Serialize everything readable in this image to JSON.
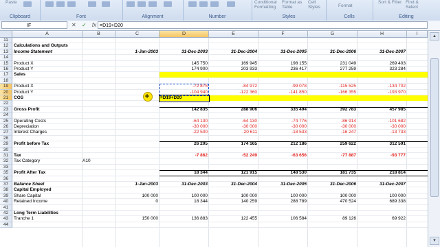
{
  "ribbon": {
    "groups": [
      {
        "label": "Clipboard"
      },
      {
        "label": "Font"
      },
      {
        "label": "Alignment"
      },
      {
        "label": "Number"
      },
      {
        "label": "Styles"
      },
      {
        "label": "Cells"
      },
      {
        "label": "Editing"
      }
    ],
    "paste": "Paste",
    "cond_format": "Conditional Formatting",
    "format_table": "Format as Table",
    "cell_styles": "Cell Styles",
    "format": "Format",
    "sort_filter": "Sort & Filter",
    "find_select": "Find & Select"
  },
  "formula_bar": {
    "name_box": "IF",
    "cancel": "✕",
    "enter": "✓",
    "fx": "fx",
    "formula": "=D19+D20"
  },
  "columns": [
    "A",
    "B",
    "C",
    "D",
    "E",
    "F",
    "G",
    "H",
    "I"
  ],
  "rows": [
    {
      "n": "11",
      "a": "",
      "b": "",
      "c": "",
      "d": "",
      "e": "",
      "f": "",
      "g": "",
      "h": ""
    },
    {
      "n": "12",
      "a": "Calculations and Outputs",
      "b": "",
      "c": "",
      "d": "",
      "e": "",
      "f": "",
      "g": "",
      "h": "",
      "bold": true
    },
    {
      "n": "13",
      "a": "Income Statement",
      "b": "",
      "c": "1-Jan-2003",
      "d": "31-Dec-2003",
      "e": "31-Dec-2004",
      "f": "31-Dec-2005",
      "g": "31-Dec-2006",
      "h": "31-Dec-2007",
      "bold": true,
      "italic": true
    },
    {
      "n": "14",
      "a": "",
      "b": "",
      "c": "",
      "d": "",
      "e": "",
      "f": "",
      "g": "",
      "h": ""
    },
    {
      "n": "15",
      "a": "Product X",
      "b": "",
      "c": "",
      "d": "145 750",
      "e": "169 945",
      "f": "198 155",
      "g": "231 049",
      "h": "269 403"
    },
    {
      "n": "16",
      "a": "Product Y",
      "b": "",
      "c": "",
      "d": "174 900",
      "e": "203 933",
      "f": "236 417",
      "g": "277 259",
      "h": "323 284"
    },
    {
      "n": "17",
      "a": "Sales",
      "b": "",
      "c": "",
      "d": "",
      "e": "",
      "f": "",
      "g": "",
      "h": "",
      "bold": true
    },
    {
      "n": "18",
      "a": "",
      "b": "",
      "c": "",
      "d": "",
      "e": "",
      "f": "",
      "g": "",
      "h": ""
    },
    {
      "n": "19",
      "a": "Product X",
      "b": "",
      "c": "",
      "d": "-72 875",
      "e": "-84 972",
      "f": "-99 078",
      "g": "-115 525",
      "h": "-134 702",
      "red": true
    },
    {
      "n": "20",
      "a": "Product Y",
      "b": "",
      "c": "",
      "d": "-104 940",
      "e": "-122 360",
      "f": "-141 850",
      "g": "-166 355",
      "h": "-193 970",
      "red": true
    },
    {
      "n": "21",
      "a": "COS",
      "b": "",
      "c": "",
      "d": "=D19+D20",
      "e": "",
      "f": "",
      "g": "",
      "h": "",
      "bold": true
    },
    {
      "n": "22",
      "a": "",
      "b": "",
      "c": "",
      "d": "",
      "e": "",
      "f": "",
      "g": "",
      "h": ""
    },
    {
      "n": "23",
      "a": "Gross Profit",
      "b": "",
      "c": "",
      "d": "142 835",
      "e": "288 906",
      "f": "335 494",
      "g": "392 783",
      "h": "457 985",
      "bold": true
    },
    {
      "n": "24",
      "a": "",
      "b": "",
      "c": "",
      "d": "",
      "e": "",
      "f": "",
      "g": "",
      "h": ""
    },
    {
      "n": "25",
      "a": "Operating Costs",
      "b": "",
      "c": "",
      "d": "-64 130",
      "e": "-64 130",
      "f": "-74 776",
      "g": "-86 914",
      "h": "-101 682",
      "red": true
    },
    {
      "n": "26",
      "a": "Depreciation",
      "b": "",
      "c": "",
      "d": "-30 000",
      "e": "-30 000",
      "f": "-30 000",
      "g": "-30 000",
      "h": "-30 000",
      "red": true
    },
    {
      "n": "27",
      "a": "Interest Charges",
      "b": "",
      "c": "",
      "d": "-22 500",
      "e": "-20 611",
      "f": "-18 533",
      "g": "-16 247",
      "h": "-13 733",
      "red": true
    },
    {
      "n": "28",
      "a": "",
      "b": "",
      "c": "",
      "d": "",
      "e": "",
      "f": "",
      "g": "",
      "h": ""
    },
    {
      "n": "29",
      "a": "Profit before Tax",
      "b": "",
      "c": "",
      "d": "26 205",
      "e": "174 165",
      "f": "212 186",
      "g": "259 622",
      "h": "312 591",
      "bold": true
    },
    {
      "n": "30",
      "a": "",
      "b": "",
      "c": "",
      "d": "",
      "e": "",
      "f": "",
      "g": "",
      "h": ""
    },
    {
      "n": "31",
      "a": "Tax",
      "b": "",
      "c": "",
      "d": "-7 862",
      "e": "-52 249",
      "f": "-63 656",
      "g": "-77 887",
      "h": "-93 777",
      "bold": true,
      "red": true
    },
    {
      "n": "32",
      "a": "Tax Category",
      "b": "A10",
      "c": "",
      "d": "",
      "e": "",
      "f": "",
      "g": "",
      "h": ""
    },
    {
      "n": "33",
      "a": "",
      "b": "",
      "c": "",
      "d": "",
      "e": "",
      "f": "",
      "g": "",
      "h": ""
    },
    {
      "n": "35",
      "a": "Profit After Tax",
      "b": "",
      "c": "",
      "d": "18 344",
      "e": "121 915",
      "f": "148 530",
      "g": "181 735",
      "h": "218 814",
      "bold": true
    },
    {
      "n": "36",
      "a": "",
      "b": "",
      "c": "",
      "d": "",
      "e": "",
      "f": "",
      "g": "",
      "h": ""
    },
    {
      "n": "37",
      "a": "Balance Sheet",
      "b": "",
      "c": "1-Jan-2003",
      "d": "31-Dec-2003",
      "e": "31-Dec-2004",
      "f": "31-Dec-2005",
      "g": "31-Dec-2006",
      "h": "31-Dec-2007",
      "bold": true,
      "italic": true
    },
    {
      "n": "38",
      "a": "Capital Employed",
      "b": "",
      "c": "",
      "d": "",
      "e": "",
      "f": "",
      "g": "",
      "h": "",
      "bold": true
    },
    {
      "n": "39",
      "a": "Share Capital",
      "b": "",
      "c": "100 000",
      "d": "100 000",
      "e": "100 000",
      "f": "100 000",
      "g": "100 000",
      "h": "100 000"
    },
    {
      "n": "40",
      "a": "Retained Income",
      "b": "",
      "c": "0",
      "d": "18 344",
      "e": "140 259",
      "f": "288 789",
      "g": "470 524",
      "h": "689 338"
    },
    {
      "n": "41",
      "a": "",
      "b": "",
      "c": "",
      "d": "",
      "e": "",
      "f": "",
      "g": "",
      "h": ""
    },
    {
      "n": "42",
      "a": "Long Term Liabilities",
      "b": "",
      "c": "",
      "d": "",
      "e": "",
      "f": "",
      "g": "",
      "h": "",
      "bold": true
    },
    {
      "n": "43",
      "a": "Tranche 1",
      "b": "",
      "c": "150 000",
      "d": "136 883",
      "e": "122 455",
      "f": "106 584",
      "g": "89 126",
      "h": "69 922"
    },
    {
      "n": "44",
      "a": "",
      "b": "",
      "c": "",
      "d": "",
      "e": "",
      "f": "",
      "g": "",
      "h": ""
    }
  ],
  "colors": {
    "yellow": "#ffff00",
    "negative": "#e0201d",
    "selected_header": "#f5c562"
  }
}
